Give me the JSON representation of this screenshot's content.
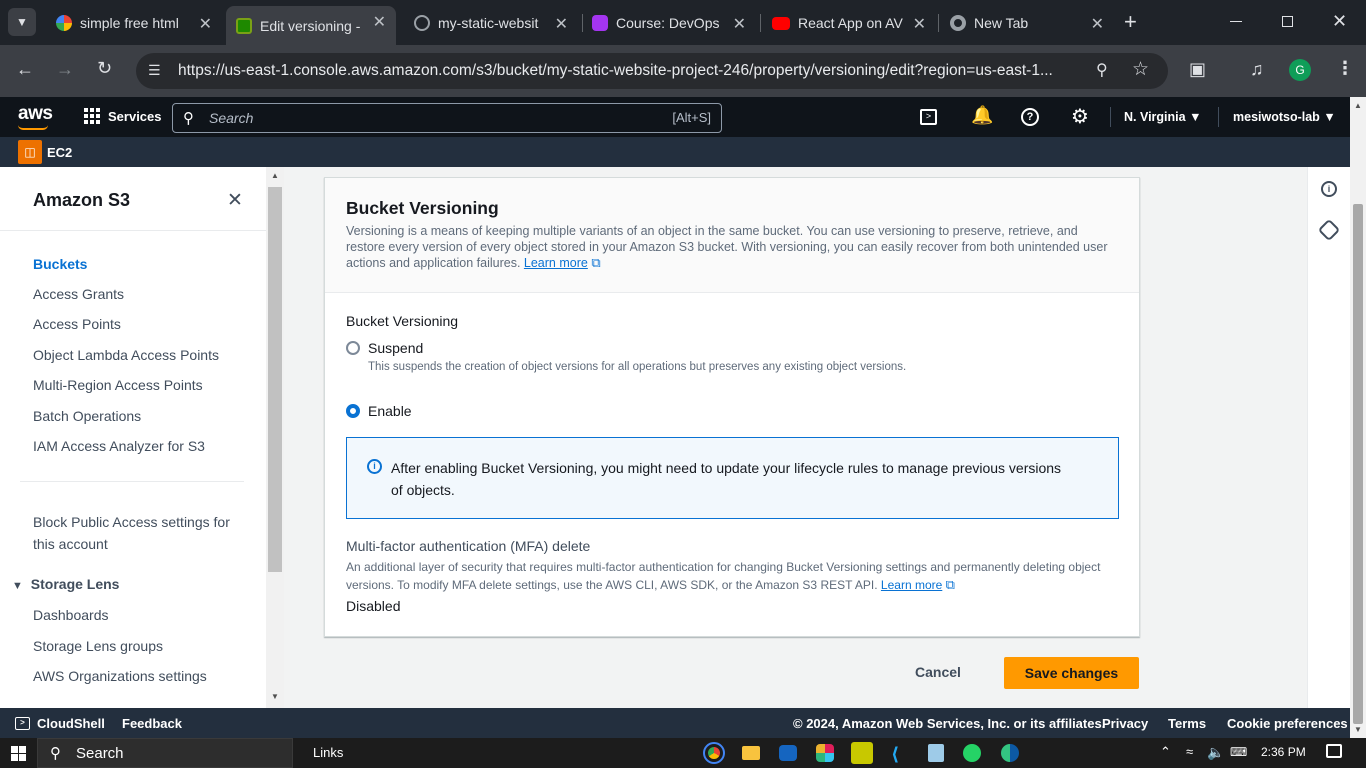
{
  "browser": {
    "tabs": [
      {
        "title": "simple free html",
        "color": "#ffffff"
      },
      {
        "title": "Edit versioning -",
        "color": "#1e8900"
      },
      {
        "title": "my-static-websit",
        "color": "#9aa0a6"
      },
      {
        "title": "Course: DevOps",
        "color": "#8e44ad"
      },
      {
        "title": "React App on AV",
        "color": "#ff0000"
      },
      {
        "title": "New Tab",
        "color": "#9aa0a6"
      }
    ],
    "url": "https://us-east-1.console.aws.amazon.com/s3/bucket/my-static-website-project-246/property/versioning/edit?region=us-east-1...",
    "profile_initial": "G"
  },
  "aws": {
    "logo": "aws",
    "services_label": "Services",
    "search_placeholder": "Search",
    "search_shortcut": "[Alt+S]",
    "region": "N. Virginia",
    "account": "mesiwotso-lab",
    "favorite_service": "EC2"
  },
  "sidebar": {
    "title": "Amazon S3",
    "items": [
      "Buckets",
      "Access Grants",
      "Access Points",
      "Object Lambda Access Points",
      "Multi-Region Access Points",
      "Batch Operations",
      "IAM Access Analyzer for S3"
    ],
    "block_public_access": "Block Public Access settings for this account",
    "storage_lens_header": "Storage Lens",
    "storage_lens_items": [
      "Dashboards",
      "Storage Lens groups",
      "AWS Organizations settings"
    ]
  },
  "panel": {
    "title": "Bucket Versioning",
    "description": "Versioning is a means of keeping multiple variants of an object in the same bucket. You can use versioning to preserve, retrieve, and restore every version of every object stored in your Amazon S3 bucket. With versioning, you can easily recover from both unintended user actions and application failures.",
    "learn_more": "Learn more",
    "field_label": "Bucket Versioning",
    "suspend_label": "Suspend",
    "suspend_desc": "This suspends the creation of object versions for all operations but preserves any existing object versions.",
    "enable_label": "Enable",
    "selected": "Enable",
    "info_alert": "After enabling Bucket Versioning, you might need to update your lifecycle rules to manage previous versions of objects.",
    "mfa_label": "Multi-factor authentication (MFA) delete",
    "mfa_desc": "An additional layer of security that requires multi-factor authentication for changing Bucket Versioning settings and permanently deleting object versions. To modify MFA delete settings, use the AWS CLI, AWS SDK, or the Amazon S3 REST API.",
    "mfa_learn_more": "Learn more",
    "mfa_value": "Disabled"
  },
  "actions": {
    "cancel": "Cancel",
    "save": "Save changes"
  },
  "footer": {
    "cloudshell": "CloudShell",
    "feedback": "Feedback",
    "copyright": "© 2024, Amazon Web Services, Inc. or its affiliates.",
    "privacy": "Privacy",
    "terms": "Terms",
    "cookies": "Cookie preferences"
  },
  "taskbar": {
    "search": "Search",
    "links": "Links",
    "time": "2:36 PM"
  },
  "colors": {
    "primary_button": "#ff9900",
    "link": "#0972d3",
    "aws_nav": "#0f141a",
    "info_bg": "#f2f8fd"
  }
}
